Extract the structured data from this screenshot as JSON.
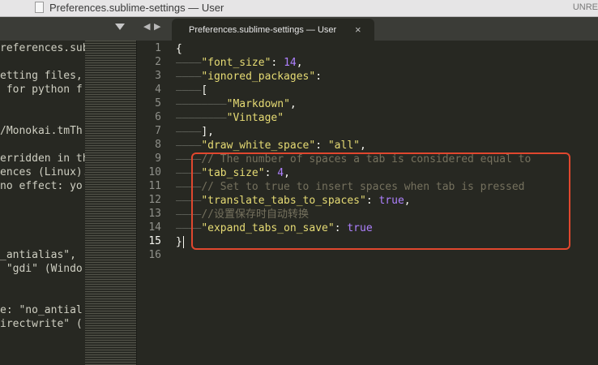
{
  "window": {
    "title": "Preferences.sublime-settings — User",
    "unregistered": "UNRE"
  },
  "tabs": {
    "nav_left": "◀",
    "nav_right": "▶",
    "active_label": "Preferences.sublime-settings — User",
    "close": "×"
  },
  "left_pane": {
    "lines": [
      "references.sub",
      "",
      "etting files,",
      " for python f",
      "",
      "",
      "/Monokai.tmTh",
      "",
      "erridden in th",
      "ences (Linux).",
      "no effect: yo",
      "",
      "",
      "",
      "",
      "_antialias\",",
      " \"gdi\" (Windo",
      "",
      "",
      "e: \"no_antial",
      "irectwrite\" ("
    ]
  },
  "editor": {
    "active_line": 15,
    "line_numbers": [
      "1",
      "2",
      "3",
      "4",
      "5",
      "6",
      "7",
      "8",
      "9",
      "10",
      "11",
      "12",
      "13",
      "14",
      "15",
      "16"
    ],
    "lines": [
      {
        "ws": "",
        "parts": [
          {
            "t": "p",
            "v": "{"
          }
        ]
      },
      {
        "ws": "————",
        "parts": [
          {
            "t": "s",
            "v": "\"font_size\""
          },
          {
            "t": "p",
            "v": ": "
          },
          {
            "t": "n",
            "v": "14"
          },
          {
            "t": "p",
            "v": ","
          }
        ]
      },
      {
        "ws": "————",
        "parts": [
          {
            "t": "s",
            "v": "\"ignored_packages\""
          },
          {
            "t": "p",
            "v": ":"
          }
        ]
      },
      {
        "ws": "————",
        "parts": [
          {
            "t": "p",
            "v": "["
          }
        ]
      },
      {
        "ws": "————————",
        "parts": [
          {
            "t": "s",
            "v": "\"Markdown\""
          },
          {
            "t": "p",
            "v": ","
          }
        ]
      },
      {
        "ws": "————————",
        "parts": [
          {
            "t": "s",
            "v": "\"Vintage\""
          }
        ]
      },
      {
        "ws": "————",
        "parts": [
          {
            "t": "p",
            "v": "],"
          }
        ]
      },
      {
        "ws": "————",
        "parts": [
          {
            "t": "s",
            "v": "\"draw_white_space\""
          },
          {
            "t": "p",
            "v": ": "
          },
          {
            "t": "s",
            "v": "\"all\""
          },
          {
            "t": "p",
            "v": ","
          }
        ]
      },
      {
        "ws": "————",
        "parts": [
          {
            "t": "c",
            "v": "// The number of spaces a tab is considered equal to"
          }
        ]
      },
      {
        "ws": "————",
        "parts": [
          {
            "t": "s",
            "v": "\"tab_size\""
          },
          {
            "t": "p",
            "v": ": "
          },
          {
            "t": "n",
            "v": "4"
          },
          {
            "t": "p",
            "v": ","
          }
        ]
      },
      {
        "ws": "————",
        "parts": [
          {
            "t": "c",
            "v": "// Set to true to insert spaces when tab is pressed"
          }
        ]
      },
      {
        "ws": "————",
        "parts": [
          {
            "t": "s",
            "v": "\"translate_tabs_to_spaces\""
          },
          {
            "t": "p",
            "v": ": "
          },
          {
            "t": "b",
            "v": "true"
          },
          {
            "t": "p",
            "v": ","
          }
        ]
      },
      {
        "ws": "————",
        "parts": [
          {
            "t": "c",
            "v": "//设置保存时自动转换"
          }
        ]
      },
      {
        "ws": "————",
        "parts": [
          {
            "t": "s",
            "v": "\"expand_tabs_on_save\""
          },
          {
            "t": "p",
            "v": ": "
          },
          {
            "t": "b",
            "v": "true"
          }
        ]
      },
      {
        "ws": "",
        "parts": [
          {
            "t": "p",
            "v": "}"
          }
        ]
      },
      {
        "ws": "",
        "parts": []
      }
    ]
  },
  "colors": {
    "background": "#272822",
    "string": "#e6db74",
    "number": "#ae81ff",
    "comment": "#75715e",
    "highlight": "#e0472e"
  }
}
